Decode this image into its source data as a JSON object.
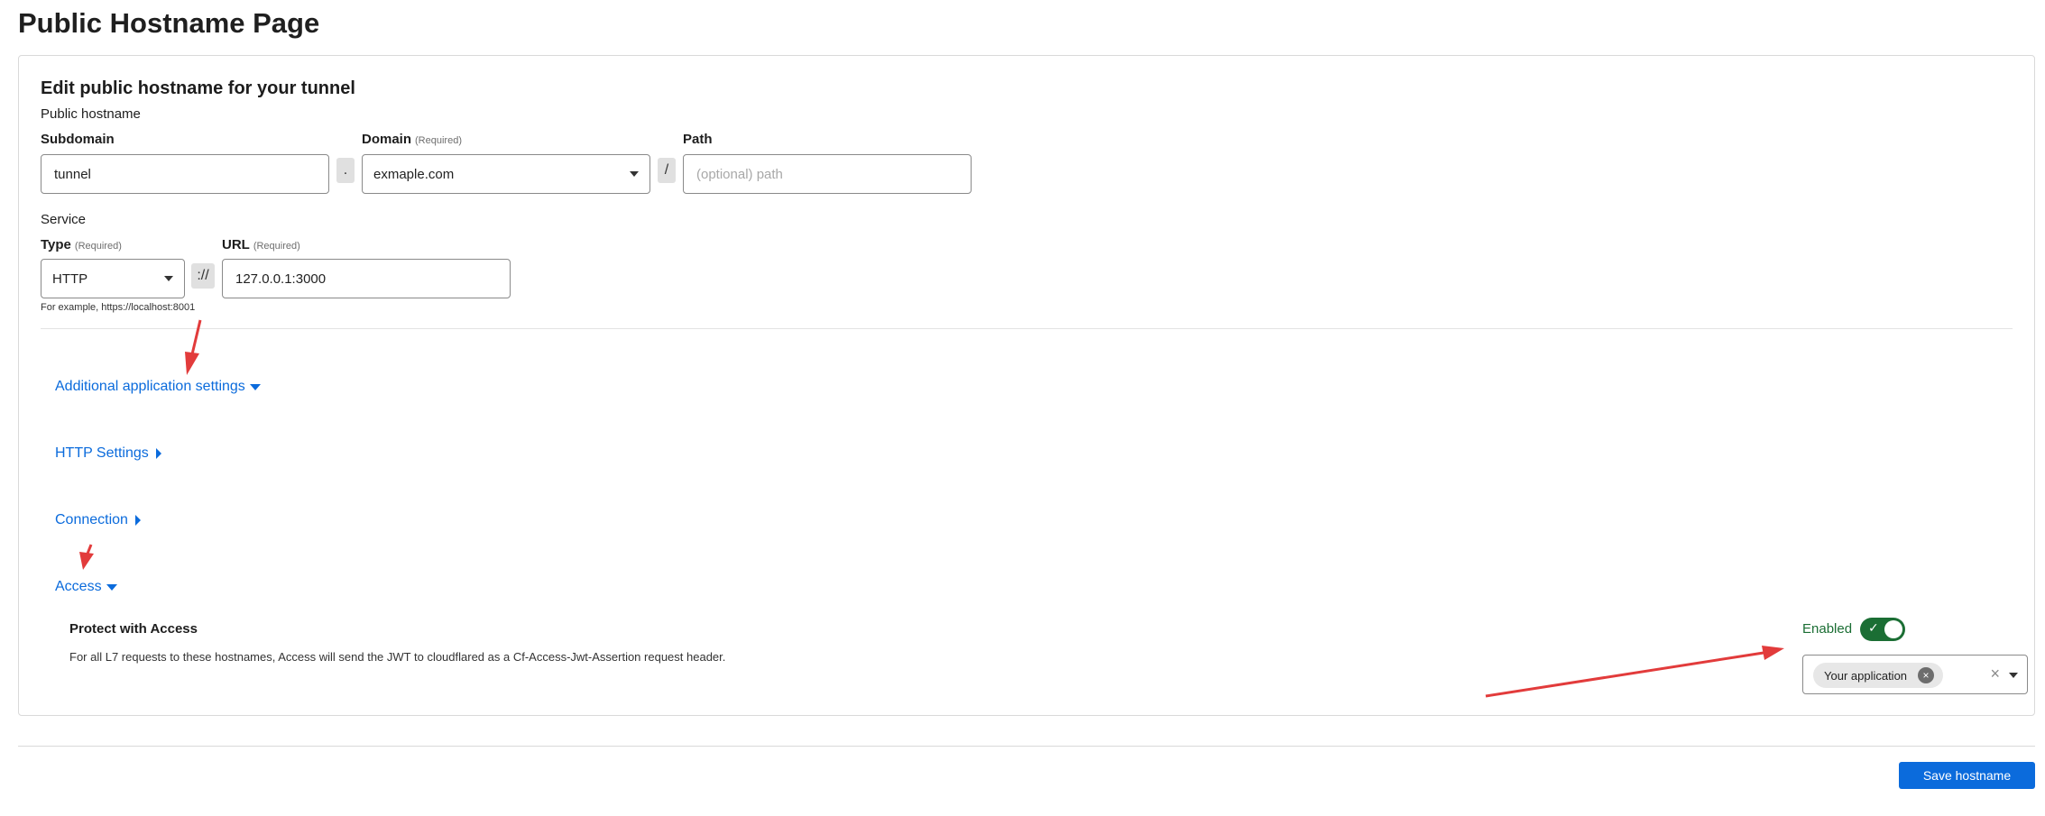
{
  "page": {
    "title": "Public Hostname Page"
  },
  "form": {
    "title": "Edit public hostname for your tunnel",
    "public_hostname_label": "Public hostname",
    "subdomain": {
      "label": "Subdomain",
      "value": "tunnel"
    },
    "dot_sep": ".",
    "domain": {
      "label": "Domain",
      "required": "(Required)",
      "value": "exmaple.com"
    },
    "slash_sep": "/",
    "path": {
      "label": "Path",
      "placeholder": "(optional) path"
    },
    "service_label": "Service",
    "type": {
      "label": "Type",
      "required": "(Required)",
      "value": "HTTP"
    },
    "scheme_sep": "://",
    "url": {
      "label": "URL",
      "required": "(Required)",
      "value": "127.0.0.1:3000"
    },
    "url_hint": "For example, https://localhost:8001"
  },
  "sections": {
    "additional": "Additional application settings",
    "http": "HTTP Settings",
    "connection": "Connection",
    "access": "Access"
  },
  "access": {
    "title": "Protect with Access",
    "description": "For all L7 requests to these hostnames, Access will send the JWT to cloudflared as a Cf-Access-Jwt-Assertion request header.",
    "enabled_label": "Enabled",
    "toggle_on": true,
    "selected_application": "Your application"
  },
  "actions": {
    "save": "Save hostname"
  },
  "colors": {
    "accent": "#0b6bdc",
    "enabled": "#1b6e34",
    "annotation": "#e23b3b"
  }
}
